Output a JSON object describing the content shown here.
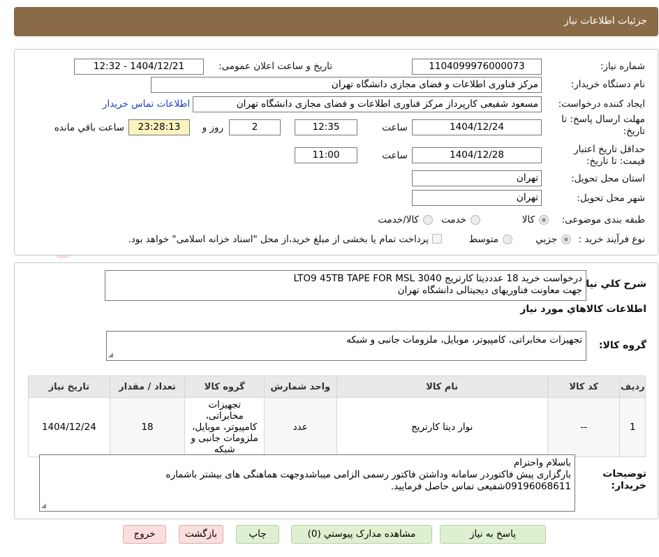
{
  "header": {
    "title": "جزئیات اطلاعات نیاز"
  },
  "watermark": {
    "text": "AriaTender.neT"
  },
  "info": {
    "need_number_label": "شماره نیاز:",
    "need_number": "1104099976000073",
    "announce_label": "تاریخ و ساعت اعلان عمومی:",
    "announce_value": "1404/12/21 - 12:32",
    "buyer_org_label": "نام دستگاه خریدار:",
    "buyer_org": "مرکز فناوری اطلاعات و فضای مجازی دانشگاه تهران",
    "creator_label": "ایجاد کننده درخواست:",
    "creator": "مسعود شفیعی کارپرداز مرکز فناوری اطلاعات و فضای مجازی دانشگاه تهران",
    "contact_link": "اطلاعات تماس خریدار",
    "deadline_label": "مهلت ارسال پاسخ: تا تاریخ:",
    "deadline_date": "1404/12/24",
    "time_label": "ساعت",
    "deadline_time": "12:35",
    "days_value": "2",
    "days_label": "روز و",
    "remaining_value": "23:28:13",
    "remaining_label": "ساعت باقي مانده",
    "validity_label": "حداقل تاریخ اعتبار قیمت: تا تاریخ:",
    "validity_date": "1404/12/28",
    "validity_time": "11:00",
    "province_label": "استان محل تحویل:",
    "province": "تهران",
    "city_label": "شهر محل تحویل:",
    "city": "تهران",
    "category_label": "طبقه بندی موضوعی:",
    "category_options": [
      "کالا",
      "خدمت",
      "کالا/خدمت"
    ],
    "category_selected": "کالا",
    "process_label": "نوع فرآیند خرید :",
    "process_options": [
      "جزیي",
      "متوسط"
    ],
    "process_selected": "جزیي",
    "payment_note": "پرداخت تمام یا بخشی از مبلغ خرید،از محل \"اسناد خزانه اسلامی\" خواهد بود."
  },
  "needs": {
    "summary_label": "شرح كلي نیاز:",
    "summary_line1": "درخواست خرید 18 عدددیتا کارتریج LTO9 45TB TAPE FOR MSL 3040",
    "summary_line2": "جهت معاونت فناوریهای دیجیتالی دانشگاه تهران",
    "goods_info_title": "اطلاعات كالاهاي مورد نیاز",
    "group_label": "گروه کالا:",
    "group_value": "تجهیزات مخابراتی، کامپیوتر، موبایل، ملزومات جانبی و شبکه",
    "table": {
      "headers": [
        "ردیف",
        "کد کالا",
        "نام کالا",
        "واحد شمارش",
        "گروه کالا",
        "تعداد / مقدار",
        "تاریخ نیاز"
      ],
      "rows": [
        {
          "index": "1",
          "code": "--",
          "name": "نوار دیتا کارتریج",
          "unit": "عدد",
          "group": "تجهیزات مخابراتی، کامپیوتر، موبایل، ملزومات جانبی و شبکه",
          "qty": "18",
          "date": "1404/12/24"
        }
      ]
    },
    "buyer_notes_label": "توضیحات خریدار:",
    "buyer_notes_line1": "باسلام واحترام",
    "buyer_notes_line2": "بارگزاری پیش فاکتوردر سامانه وداشتن فاکتور رسمی الزامی میباشدوجهت هماهنگی های بیشتر باشماره",
    "buyer_notes_line3": "09196068611شفیعی تماس حاصل فرمایید."
  },
  "buttons": {
    "reply": "پاسخ به نیاز",
    "attachments": "مشاهده مدارک پیوستي (0)",
    "print": "چاپ",
    "back": "بازگشت",
    "exit": "خروج"
  }
}
